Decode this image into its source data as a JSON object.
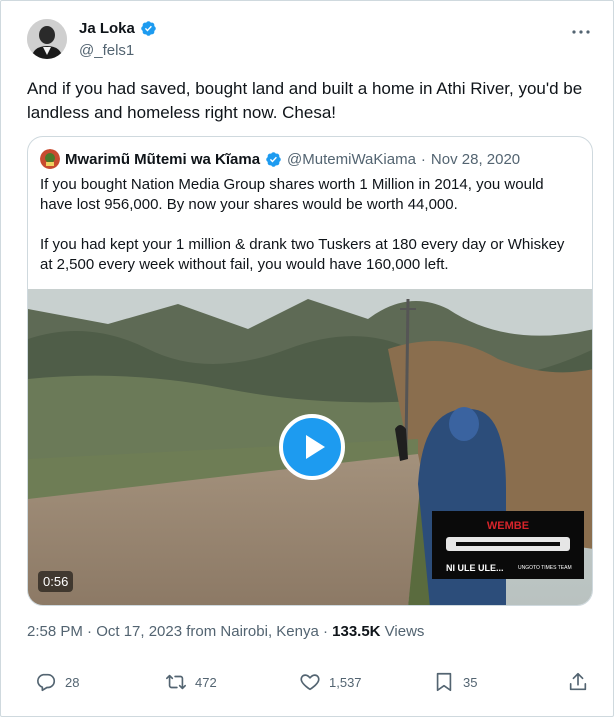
{
  "author": {
    "name": "Ja Loka",
    "handle": "@_fels1"
  },
  "tweet_text": "And if you had saved, bought land and built a home in Athi River, you'd be landless and homeless right now. Chesa!",
  "quote": {
    "name": "Mwarimũ Mũtemi wa Kĩama",
    "handle": "@MutemiWaKiama",
    "separator": "·",
    "date": "Nov 28, 2020",
    "paragraphs": [
      "If you bought Nation Media Group shares worth 1 Million in 2014, you would have lost 956,000. By now your shares would be worth 44,000.",
      "If you had kept your 1 million & drank two Tuskers at 180 every day or Whiskey at 2,500 every week without fail, you would have 160,000 left."
    ],
    "video": {
      "duration": "0:56",
      "watermark_top": "WEMBE",
      "watermark_bottom": "NI ULE ULE...",
      "watermark_small": "UNGOTO TIMES TEAM"
    }
  },
  "timestamp": {
    "time_date": "2:58 PM · Oct 17, 2023 from Nairobi, Kenya · ",
    "views_count": "133.5K",
    "views_label": " Views"
  },
  "actions": {
    "replies": "28",
    "retweets": "472",
    "likes": "1,537",
    "bookmarks": "35"
  },
  "icons": [
    "verified-badge-icon",
    "more-icon",
    "play-icon",
    "reply-icon",
    "retweet-icon",
    "like-icon",
    "bookmark-icon",
    "share-icon"
  ],
  "colors": {
    "accent": "#1d9bf0",
    "secondary_text": "#536471",
    "border": "#cfd9de"
  }
}
